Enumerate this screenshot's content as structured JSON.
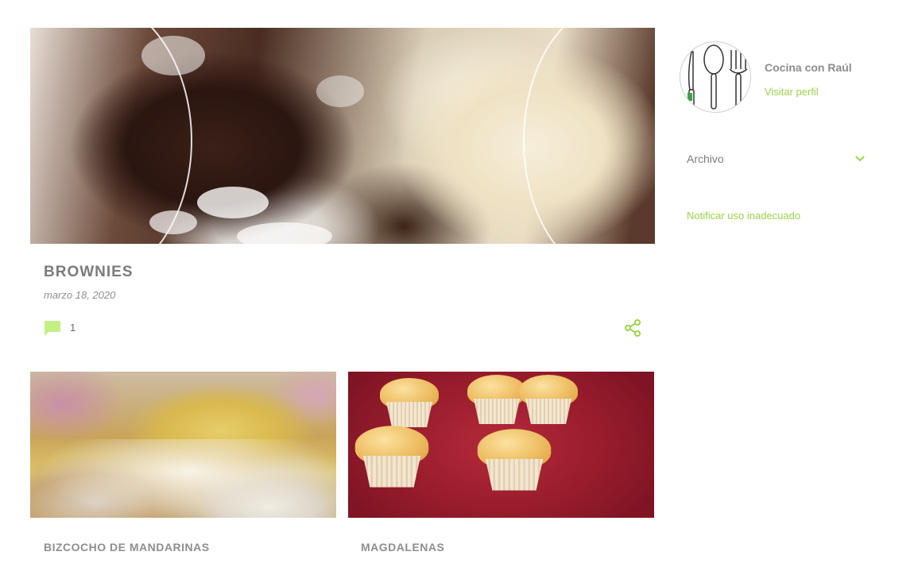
{
  "featured_post": {
    "image_alt": "Brownies con helado",
    "title": "BROWNIES",
    "date": "marzo 18, 2020",
    "comment_count": "1",
    "comment_icon": "comment-icon",
    "share_icon": "share-icon"
  },
  "posts": [
    {
      "image_alt": "Bizcocho de mandarinas",
      "title": "BIZCOCHO DE MANDARINAS"
    },
    {
      "image_alt": "Magdalenas",
      "title": "MAGDALENAS"
    }
  ],
  "sidebar": {
    "profile": {
      "avatar_icon": "cutlery-icon",
      "name": "Cocina con Raúl",
      "visit_label": "Visitar perfil"
    },
    "archive": {
      "label": "Archivo",
      "toggle_icon": "chevron-down-icon"
    },
    "report_label": "Notificar uso inadecuado"
  },
  "colors": {
    "accent": "#9bd34a",
    "title_gray": "#7b7b7b"
  }
}
